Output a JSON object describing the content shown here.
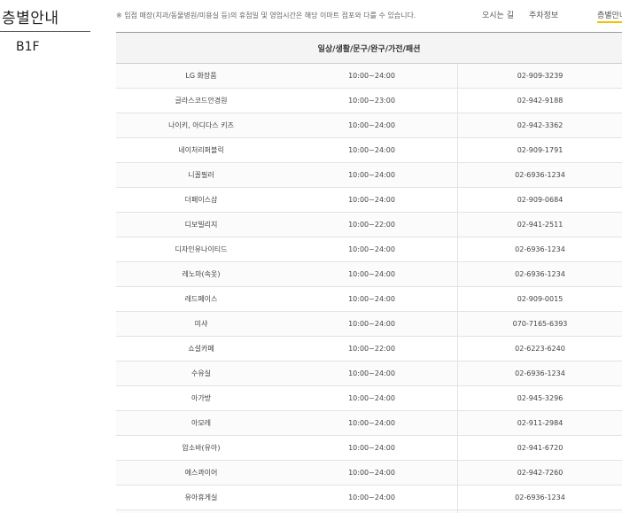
{
  "page": {
    "title": "층별안내",
    "floor": "B1F",
    "notice": "※ 입점 매장(치과/동물병원/미용실 등)의 휴점일 및 영업시간은 해당 이마트 점포와 다를 수 있습니다."
  },
  "topnav": {
    "directions": "오시는 길",
    "parking": "주차정보",
    "floor_guide": "층별안내"
  },
  "table": {
    "category": "일상/생활/문구/완구/가전/패션",
    "rows": [
      {
        "name": "LG 화장품",
        "hours": "10:00~24:00",
        "phone": "02-909-3239"
      },
      {
        "name": "글라스코드안경원",
        "hours": "10:00~23:00",
        "phone": "02-942-9188"
      },
      {
        "name": "나이키, 아디다스 키즈",
        "hours": "10:00~24:00",
        "phone": "02-942-3362"
      },
      {
        "name": "네이처리퍼블릭",
        "hours": "10:00~24:00",
        "phone": "02-909-1791"
      },
      {
        "name": "니꼴필러",
        "hours": "10:00~24:00",
        "phone": "02-6936-1234"
      },
      {
        "name": "더페이스샵",
        "hours": "10:00~24:00",
        "phone": "02-909-0684"
      },
      {
        "name": "디보빌리지",
        "hours": "10:00~22:00",
        "phone": "02-941-2511"
      },
      {
        "name": "디자인유나이티드",
        "hours": "10:00~24:00",
        "phone": "02-6936-1234"
      },
      {
        "name": "레노마(속옷)",
        "hours": "10:00~24:00",
        "phone": "02-6936-1234"
      },
      {
        "name": "레드페이스",
        "hours": "10:00~24:00",
        "phone": "02-909-0015"
      },
      {
        "name": "미샤",
        "hours": "10:00~24:00",
        "phone": "070-7165-6393"
      },
      {
        "name": "쇼설카페",
        "hours": "10:00~22:00",
        "phone": "02-6223-6240"
      },
      {
        "name": "수유실",
        "hours": "10:00~24:00",
        "phone": "02-6936-1234"
      },
      {
        "name": "아가방",
        "hours": "10:00~24:00",
        "phone": "02-945-3296"
      },
      {
        "name": "아모레",
        "hours": "10:00~24:00",
        "phone": "02-911-2984"
      },
      {
        "name": "압소바(유아)",
        "hours": "10:00~24:00",
        "phone": "02-941-6720"
      },
      {
        "name": "에스콰이어",
        "hours": "10:00~24:00",
        "phone": "02-942-7260"
      },
      {
        "name": "유아휴게실",
        "hours": "10:00~24:00",
        "phone": "02-6936-1234"
      },
      {
        "name": "",
        "hours": "",
        "phone": ""
      }
    ]
  }
}
